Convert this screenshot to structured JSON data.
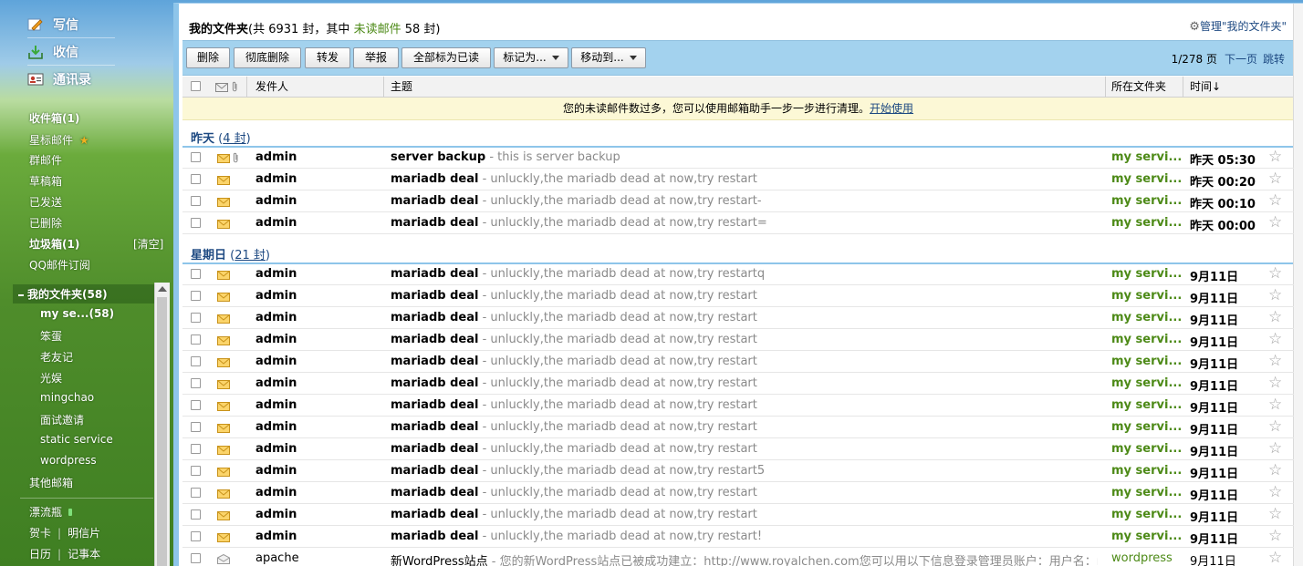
{
  "sidebar": {
    "write": "写信",
    "receive": "收信",
    "contacts": "通讯录",
    "inbox": "收件箱(1)",
    "starred": "星标邮件",
    "group_mail": "群邮件",
    "drafts": "草稿箱",
    "sent": "已发送",
    "deleted": "已删除",
    "junk": "垃圾箱(1)",
    "clean": "[清空]",
    "qq_subscription": "QQ邮件订阅",
    "my_folders": "我的文件夹(58)",
    "folders": [
      "my se...(58)",
      "笨蛋",
      "老友记",
      "光娱",
      "mingchao",
      "面试邀请",
      "static service",
      "wordpress"
    ],
    "other_mailbox": "其他邮箱",
    "drift_bottle": "漂流瓶",
    "greeting_card": "贺卡",
    "postcard": "明信片",
    "calendar": "日历",
    "notebook": "记事本"
  },
  "header": {
    "title": "我的文件夹",
    "summary_prefix": "(共 6931 封，其中 ",
    "unread_label": "未读邮件",
    "summary_suffix": " 58 封)",
    "manage": "管理\"我的文件夹\""
  },
  "toolbar": {
    "delete": "删除",
    "purge": "彻底删除",
    "forward": "转发",
    "report": "举报",
    "mark_all_read": "全部标为已读",
    "mark_as": "标记为...",
    "move_to": "移动到...",
    "page_info": "1/278 页",
    "next_page": "下一页",
    "jump": "跳转"
  },
  "columns": {
    "sender": "发件人",
    "subject": "主题",
    "folder": "所在文件夹",
    "time": "时间↓"
  },
  "notice": {
    "text": "您的未读邮件数过多，您可以使用邮箱助手一步一步进行清理。",
    "link": "开始使用"
  },
  "groups": [
    {
      "label": "昨天",
      "open": " (",
      "count": "4 封",
      "close": ")"
    },
    {
      "label": "星期日",
      "open": " (",
      "count": "21 封",
      "close": ")"
    }
  ],
  "emails": [
    {
      "sender": "admin",
      "subject": "server backup",
      "preview": "this is server backup",
      "folder": "my servi...",
      "time": "昨天 05:30"
    },
    {
      "sender": "admin",
      "subject": "mariadb deal",
      "preview": "unluckly,the mariadb dead at now,try restart",
      "folder": "my servi...",
      "time": "昨天 00:20"
    },
    {
      "sender": "admin",
      "subject": "mariadb deal",
      "preview": "unluckly,the mariadb dead at now,try restart-",
      "folder": "my servi...",
      "time": "昨天 00:10"
    },
    {
      "sender": "admin",
      "subject": "mariadb deal",
      "preview": "unluckly,the mariadb dead at now,try restart=",
      "folder": "my servi...",
      "time": "昨天 00:00"
    },
    {
      "sender": "admin",
      "subject": "mariadb deal",
      "preview": "unluckly,the mariadb dead at now,try restartq",
      "folder": "my servi...",
      "time": "9月11日"
    },
    {
      "sender": "admin",
      "subject": "mariadb deal",
      "preview": "unluckly,the mariadb dead at now,try restart",
      "folder": "my servi...",
      "time": "9月11日"
    },
    {
      "sender": "admin",
      "subject": "mariadb deal",
      "preview": "unluckly,the mariadb dead at now,try restart",
      "folder": "my servi...",
      "time": "9月11日"
    },
    {
      "sender": "admin",
      "subject": "mariadb deal",
      "preview": "unluckly,the mariadb dead at now,try restart",
      "folder": "my servi...",
      "time": "9月11日"
    },
    {
      "sender": "admin",
      "subject": "mariadb deal",
      "preview": "unluckly,the mariadb dead at now,try restart",
      "folder": "my servi...",
      "time": "9月11日"
    },
    {
      "sender": "admin",
      "subject": "mariadb deal",
      "preview": "unluckly,the mariadb dead at now,try restart",
      "folder": "my servi...",
      "time": "9月11日"
    },
    {
      "sender": "admin",
      "subject": "mariadb deal",
      "preview": "unluckly,the mariadb dead at now,try restart",
      "folder": "my servi...",
      "time": "9月11日"
    },
    {
      "sender": "admin",
      "subject": "mariadb deal",
      "preview": "unluckly,the mariadb dead at now,try restart",
      "folder": "my servi...",
      "time": "9月11日"
    },
    {
      "sender": "admin",
      "subject": "mariadb deal",
      "preview": "unluckly,the mariadb dead at now,try restart",
      "folder": "my servi...",
      "time": "9月11日"
    },
    {
      "sender": "admin",
      "subject": "mariadb deal",
      "preview": "unluckly,the mariadb dead at now,try restart5",
      "folder": "my servi...",
      "time": "9月11日"
    },
    {
      "sender": "admin",
      "subject": "mariadb deal",
      "preview": "unluckly,the mariadb dead at now,try restart",
      "folder": "my servi...",
      "time": "9月11日"
    },
    {
      "sender": "admin",
      "subject": "mariadb deal",
      "preview": "unluckly,the mariadb dead at now,try restart",
      "folder": "my servi...",
      "time": "9月11日"
    },
    {
      "sender": "admin",
      "subject": "mariadb deal",
      "preview": "unluckly,the mariadb dead at now,try restart!",
      "folder": "my servi...",
      "time": "9月11日"
    },
    {
      "sender": "apache",
      "subject": "新WordPress站点",
      "preview": "您的新WordPress站点已被成功建立：http://www.royalchen.com您可以用以下信息登录管理员账户：用户名：ro",
      "folder": "wordpress",
      "time": "9月11日"
    }
  ],
  "icons": {
    "write": "pencil-icon",
    "receive": "inbox-arrow-icon",
    "contacts": "contact-card-icon",
    "star": "star-icon",
    "envelope": "envelope-icon",
    "attachment": "paperclip-icon",
    "settings": "gear-icon"
  },
  "colors": {
    "link": "#1e4a82",
    "folder_green": "#4d8a17",
    "toolbar": "#a3d2ee",
    "notice_bg": "#fcf8d6",
    "star_badge": "#f0b020"
  }
}
